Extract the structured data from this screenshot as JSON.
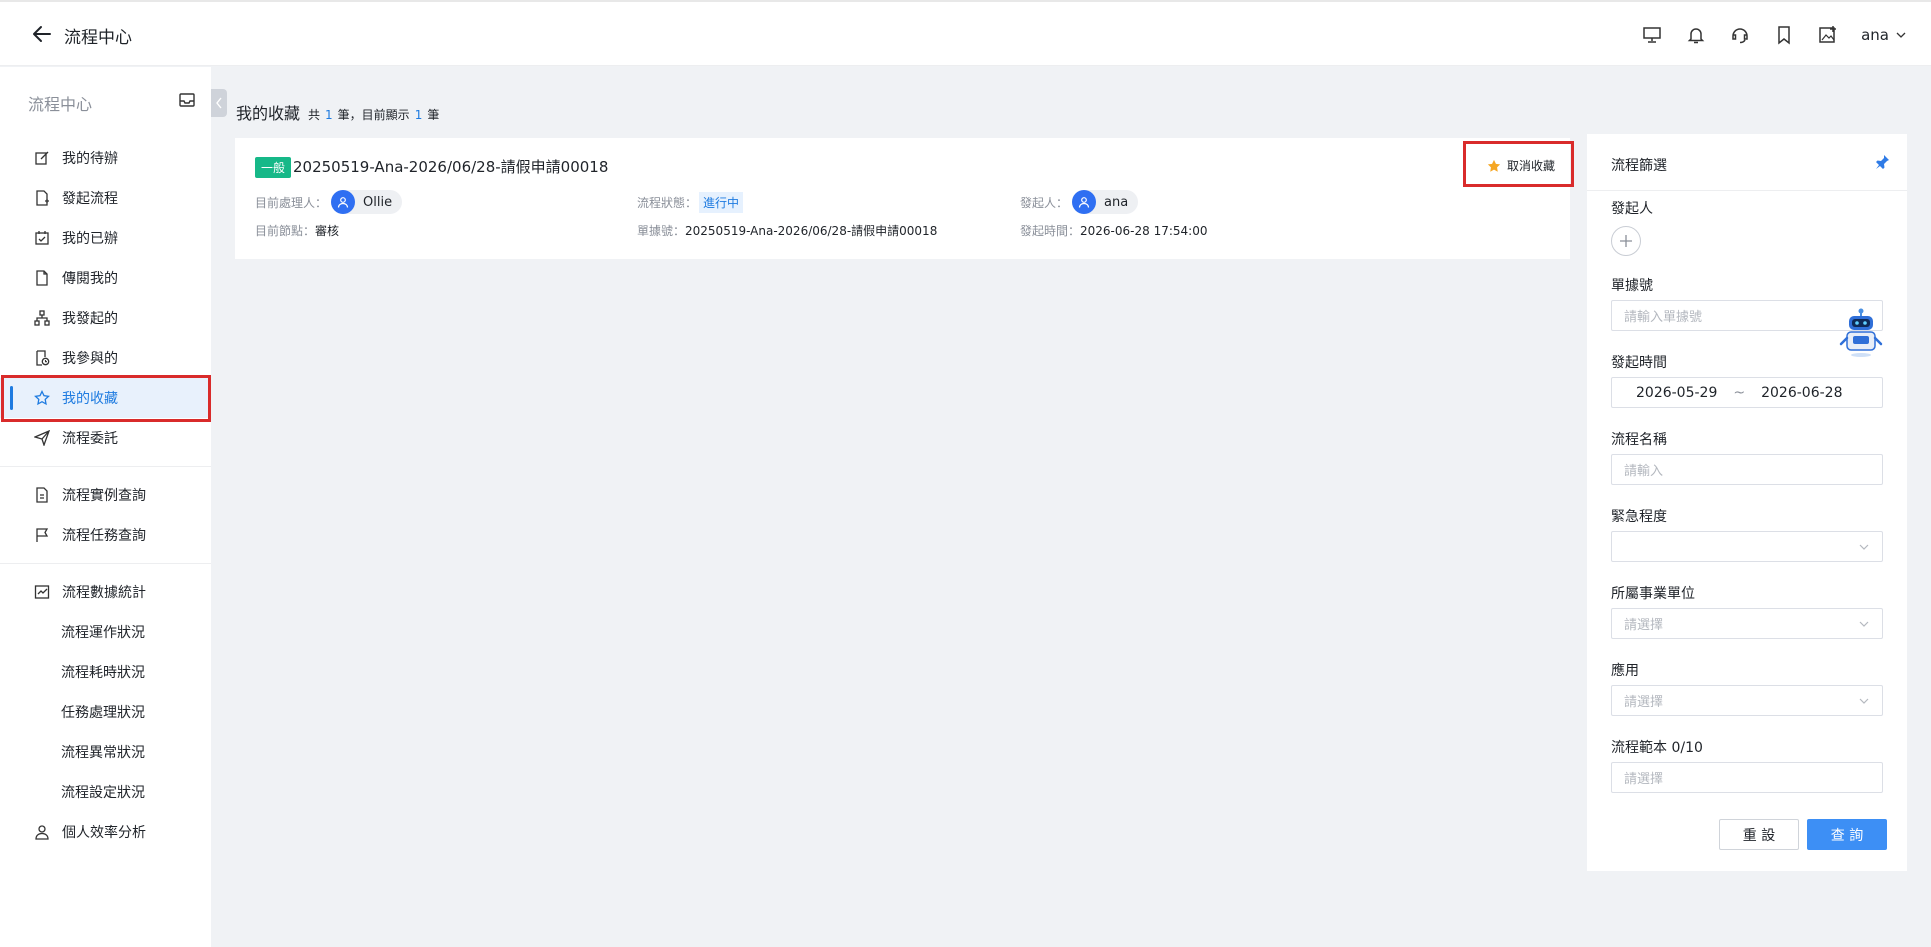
{
  "header": {
    "title": "流程中心",
    "icons": [
      "monitor-icon",
      "bell-icon",
      "headset-icon",
      "bookmark-icon",
      "image-add-icon"
    ],
    "user": "ana"
  },
  "sidebar": {
    "section_title": "流程中心",
    "items": [
      {
        "label": "我的待辦",
        "icon": "edit-icon"
      },
      {
        "label": "發起流程",
        "icon": "file-add-icon"
      },
      {
        "label": "我的已辦",
        "icon": "check-calendar-icon"
      },
      {
        "label": "傳閱我的",
        "icon": "file-icon"
      },
      {
        "label": "我發起的",
        "icon": "org-tree-icon"
      },
      {
        "label": "我參與的",
        "icon": "file-clock-icon"
      },
      {
        "label": "我的收藏",
        "icon": "star-icon",
        "active": true
      },
      {
        "label": "流程委託",
        "icon": "send-icon"
      }
    ],
    "group2": [
      {
        "label": "流程實例查詢",
        "icon": "file-search-icon"
      },
      {
        "label": "流程任務查詢",
        "icon": "flag-icon"
      }
    ],
    "group3": {
      "label": "流程數據統計",
      "icon": "chart-icon",
      "children": [
        "流程運作狀況",
        "流程耗時狀況",
        "任務處理狀況",
        "流程異常狀況",
        "流程設定狀況"
      ]
    },
    "personal": {
      "label": "個人效率分析",
      "icon": "user-icon"
    }
  },
  "main": {
    "title": "我的收藏",
    "count_prefix": "共",
    "total": "1",
    "count_mid": "筆，目前顯示",
    "shown": "1",
    "count_suffix": "筆"
  },
  "card": {
    "tag": "一般",
    "title": "20250519-Ana-2026/06/28-請假申請00018",
    "unfavorite": "取消收藏",
    "handler_label": "目前處理人：",
    "handler": "Ollie",
    "node_label": "目前節點：",
    "node": "審核",
    "status_label": "流程狀態：",
    "status": "進行中",
    "doc_label": "單據號：",
    "doc": "20250519-Ana-2026/06/28-請假申請00018",
    "initiator_label": "發起人：",
    "initiator": "ana",
    "time_label": "發起時間：",
    "time": "2026-06-28 17:54:00"
  },
  "filter": {
    "title": "流程篩選",
    "initiator_label": "發起人",
    "doc_label": "單據號",
    "doc_placeholder": "請輸入單據號",
    "time_label": "發起時間",
    "date_from": "2026-05-29",
    "date_sep": "~",
    "date_to": "2026-06-28",
    "name_label": "流程名稱",
    "name_placeholder": "請輸入",
    "urgency_label": "緊急程度",
    "unit_label": "所屬事業單位",
    "unit_placeholder": "請選擇",
    "app_label": "應用",
    "app_placeholder": "請選擇",
    "template_label": "流程範本 0/10",
    "template_placeholder": "請選擇",
    "reset": "重 設",
    "query": "查 詢"
  }
}
